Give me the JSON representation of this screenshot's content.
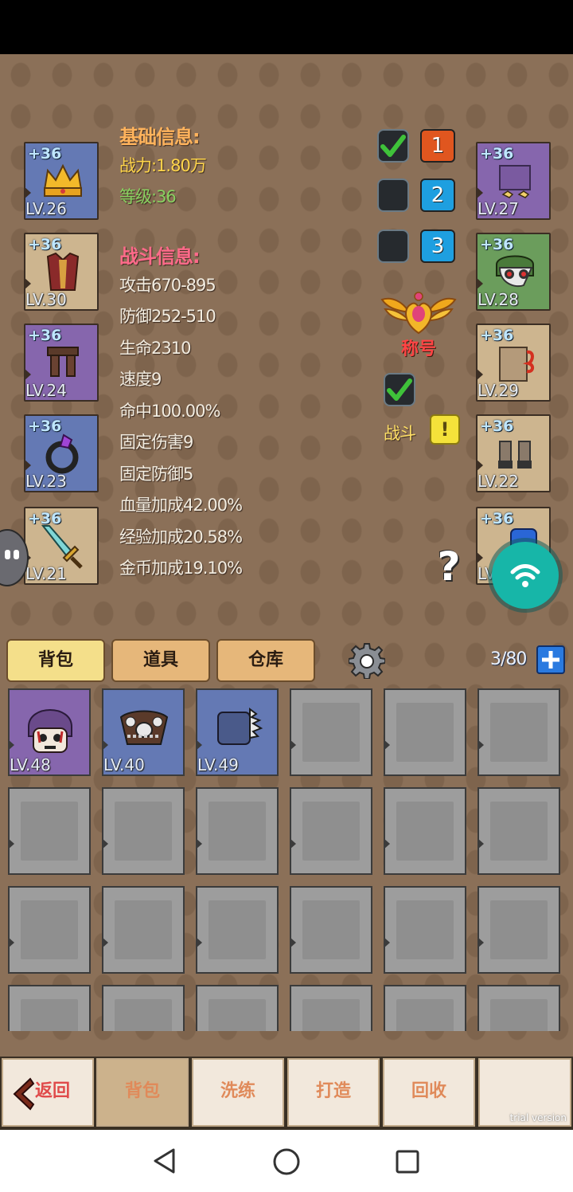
{
  "equipment_left": [
    {
      "plus": "+36",
      "level": "LV.26",
      "color": "blue",
      "icon": "crown-icon"
    },
    {
      "plus": "+36",
      "level": "LV.30",
      "color": "tan",
      "icon": "armor-icon"
    },
    {
      "plus": "+36",
      "level": "LV.24",
      "color": "purple",
      "icon": "pants-icon"
    },
    {
      "plus": "+36",
      "level": "LV.23",
      "color": "blue",
      "icon": "ring-icon"
    },
    {
      "plus": "+36",
      "level": "LV.21",
      "color": "tan",
      "icon": "sword-icon"
    }
  ],
  "equipment_right": [
    {
      "plus": "+36",
      "level": "LV.27",
      "color": "purple",
      "icon": "gloves-icon"
    },
    {
      "plus": "+36",
      "level": "LV.28",
      "color": "green",
      "icon": "mask-icon"
    },
    {
      "plus": "+36",
      "level": "LV.29",
      "color": "tan",
      "icon": "cloak-icon"
    },
    {
      "plus": "+36",
      "level": "LV.22",
      "color": "tan",
      "icon": "boots-icon"
    },
    {
      "plus": "+36",
      "level": "LV",
      "color": "tan",
      "icon": "potion-icon"
    }
  ],
  "basic_info": {
    "title": "基础信息:",
    "power": "战力:1.80万",
    "level": "等级:36"
  },
  "battle_info": {
    "title": "战斗信息:",
    "stats": [
      "攻击670-895",
      "防御252-510",
      "生命2310",
      "速度9",
      "命中100.00%",
      "固定伤害9",
      "固定防御5",
      "血量加成42.00%",
      "经验加成20.58%",
      "金币加成19.10%"
    ]
  },
  "presets": [
    {
      "label": "1",
      "checked": true,
      "color": "#e0561f"
    },
    {
      "label": "2",
      "checked": false,
      "color": "#1e9fe0"
    },
    {
      "label": "3",
      "checked": false,
      "color": "#1e9fe0"
    }
  ],
  "title_badge": {
    "label": "称号"
  },
  "battle_toggle": {
    "label": "战斗",
    "checked": true,
    "alert": "!"
  },
  "help": {
    "label": "?"
  },
  "tabs": [
    "背包",
    "道具",
    "仓库"
  ],
  "capacity": "3/80",
  "inventory_items": [
    {
      "level": "LV.48",
      "color": "purple",
      "icon": "skull-mask-icon"
    },
    {
      "level": "LV.40",
      "color": "blue",
      "icon": "bone-necklace-icon"
    },
    {
      "level": "LV.49",
      "color": "blue",
      "icon": "spiked-armor-icon"
    }
  ],
  "bottom_menu": {
    "back": "返回",
    "items": [
      "背包",
      "洗练",
      "打造",
      "回收",
      ""
    ]
  },
  "watermark": "trial version"
}
